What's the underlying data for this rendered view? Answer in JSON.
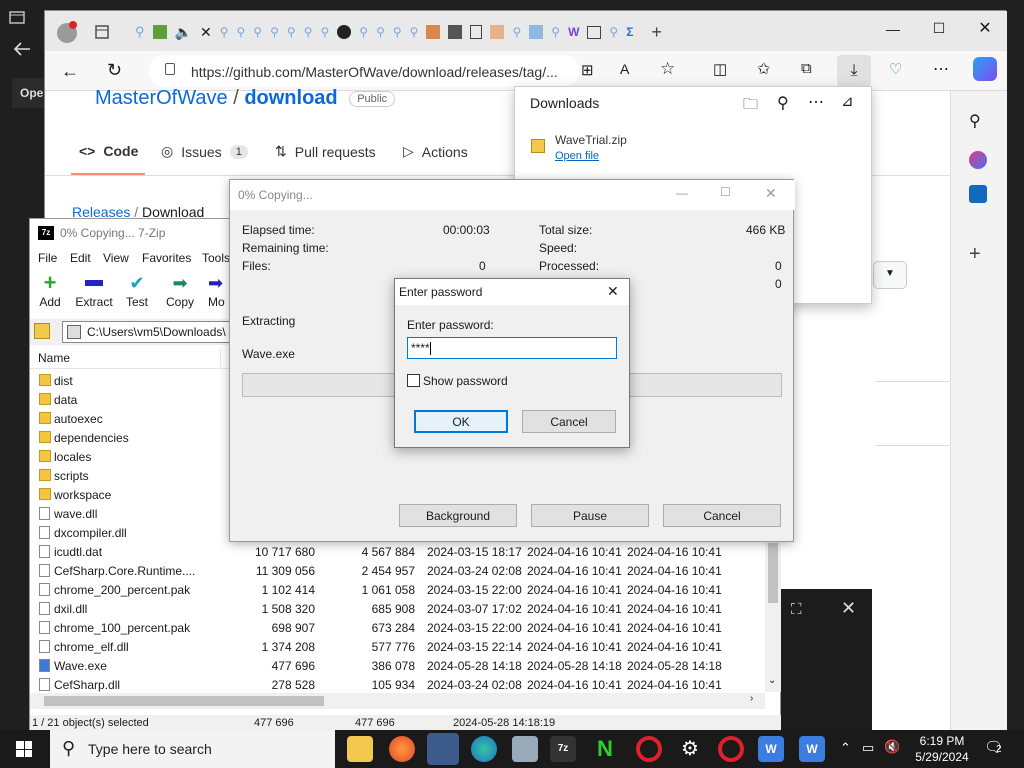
{
  "browser": {
    "url": "https://github.com/MasterOfWave/download/releases/tag/...",
    "repo_owner": "MasterOfWave",
    "repo_name": "download",
    "visibility": "Public",
    "tabs": [
      "Code",
      "Issues",
      "Pull requests",
      "Actions"
    ],
    "issues_count": "1",
    "breadcrumb": [
      "Releases",
      "Download"
    ],
    "opera_strip": "Ope"
  },
  "downloads_panel": {
    "title": "Downloads",
    "file_name": "WaveTrial.zip",
    "action": "Open file"
  },
  "zip_window": {
    "title": "0% Copying... 7-Zip",
    "menu": [
      "File",
      "Edit",
      "View",
      "Favorites",
      "Tools"
    ],
    "toolbar": [
      "Add",
      "Extract",
      "Test",
      "Copy",
      "Mo"
    ],
    "path": "C:\\Users\\vm5\\Downloads\\",
    "column_name": "Name",
    "folders": [
      "dist",
      "data",
      "autoexec",
      "dependencies",
      "locales",
      "scripts",
      "workspace"
    ],
    "files": [
      {
        "name": "wave.dll",
        "size": "",
        "packed": "",
        "modified": "",
        "created": "",
        "accessed": ""
      },
      {
        "name": "dxcompiler.dll",
        "size": "",
        "packed": "",
        "modified": "",
        "created": "",
        "accessed": ""
      },
      {
        "name": "icudtl.dat",
        "size": "10 717 680",
        "packed": "4 567 884",
        "modified": "2024-03-15 18:17",
        "created": "2024-04-16 10:41",
        "accessed": "2024-04-16 10:41"
      },
      {
        "name": "CefSharp.Core.Runtime....",
        "size": "11 309 056",
        "packed": "2 454 957",
        "modified": "2024-03-24 02:08",
        "created": "2024-04-16 10:41",
        "accessed": "2024-04-16 10:41"
      },
      {
        "name": "chrome_200_percent.pak",
        "size": "1 102 414",
        "packed": "1 061 058",
        "modified": "2024-03-15 22:00",
        "created": "2024-04-16 10:41",
        "accessed": "2024-04-16 10:41"
      },
      {
        "name": "dxil.dll",
        "size": "1 508 320",
        "packed": "685 908",
        "modified": "2024-03-07 17:02",
        "created": "2024-04-16 10:41",
        "accessed": "2024-04-16 10:41"
      },
      {
        "name": "chrome_100_percent.pak",
        "size": "698 907",
        "packed": "673 284",
        "modified": "2024-03-15 22:00",
        "created": "2024-04-16 10:41",
        "accessed": "2024-04-16 10:41"
      },
      {
        "name": "chrome_elf.dll",
        "size": "1 374 208",
        "packed": "577 776",
        "modified": "2024-03-15 22:14",
        "created": "2024-04-16 10:41",
        "accessed": "2024-04-16 10:41"
      },
      {
        "name": "Wave.exe",
        "size": "477 696",
        "packed": "386 078",
        "modified": "2024-05-28 14:18",
        "created": "2024-05-28 14:18",
        "accessed": "2024-05-28 14:18"
      },
      {
        "name": "CefSharp.dll",
        "size": "278 528",
        "packed": "105 934",
        "modified": "2024-03-24 02:08",
        "created": "2024-04-16 10:41",
        "accessed": "2024-04-16 10:41"
      }
    ],
    "status": {
      "selected": "1 / 21 object(s) selected",
      "size": "477 696",
      "packed": "477 696",
      "date": "2024-05-28 14:18:19"
    }
  },
  "progress_dialog": {
    "title": "0% Copying...",
    "elapsed_label": "Elapsed time:",
    "elapsed_value": "00:00:03",
    "remaining_label": "Remaining time:",
    "files_label": "Files:",
    "files_value": "0",
    "total_label": "Total size:",
    "total_value": "466 KB",
    "speed_label": "Speed:",
    "processed_label": "Processed:",
    "processed_value": "0",
    "extra_value": "0",
    "action_label": "Extracting",
    "current_file": "Wave.exe",
    "buttons": [
      "Background",
      "Pause",
      "Cancel"
    ]
  },
  "password_dialog": {
    "title": "Enter password",
    "prompt": "Enter password:",
    "value": "****",
    "show_password": "Show password",
    "ok": "OK",
    "cancel": "Cancel"
  },
  "taskbar": {
    "search_placeholder": "Type here to search",
    "time": "6:19 PM",
    "date": "5/29/2024",
    "notifications": "2"
  }
}
